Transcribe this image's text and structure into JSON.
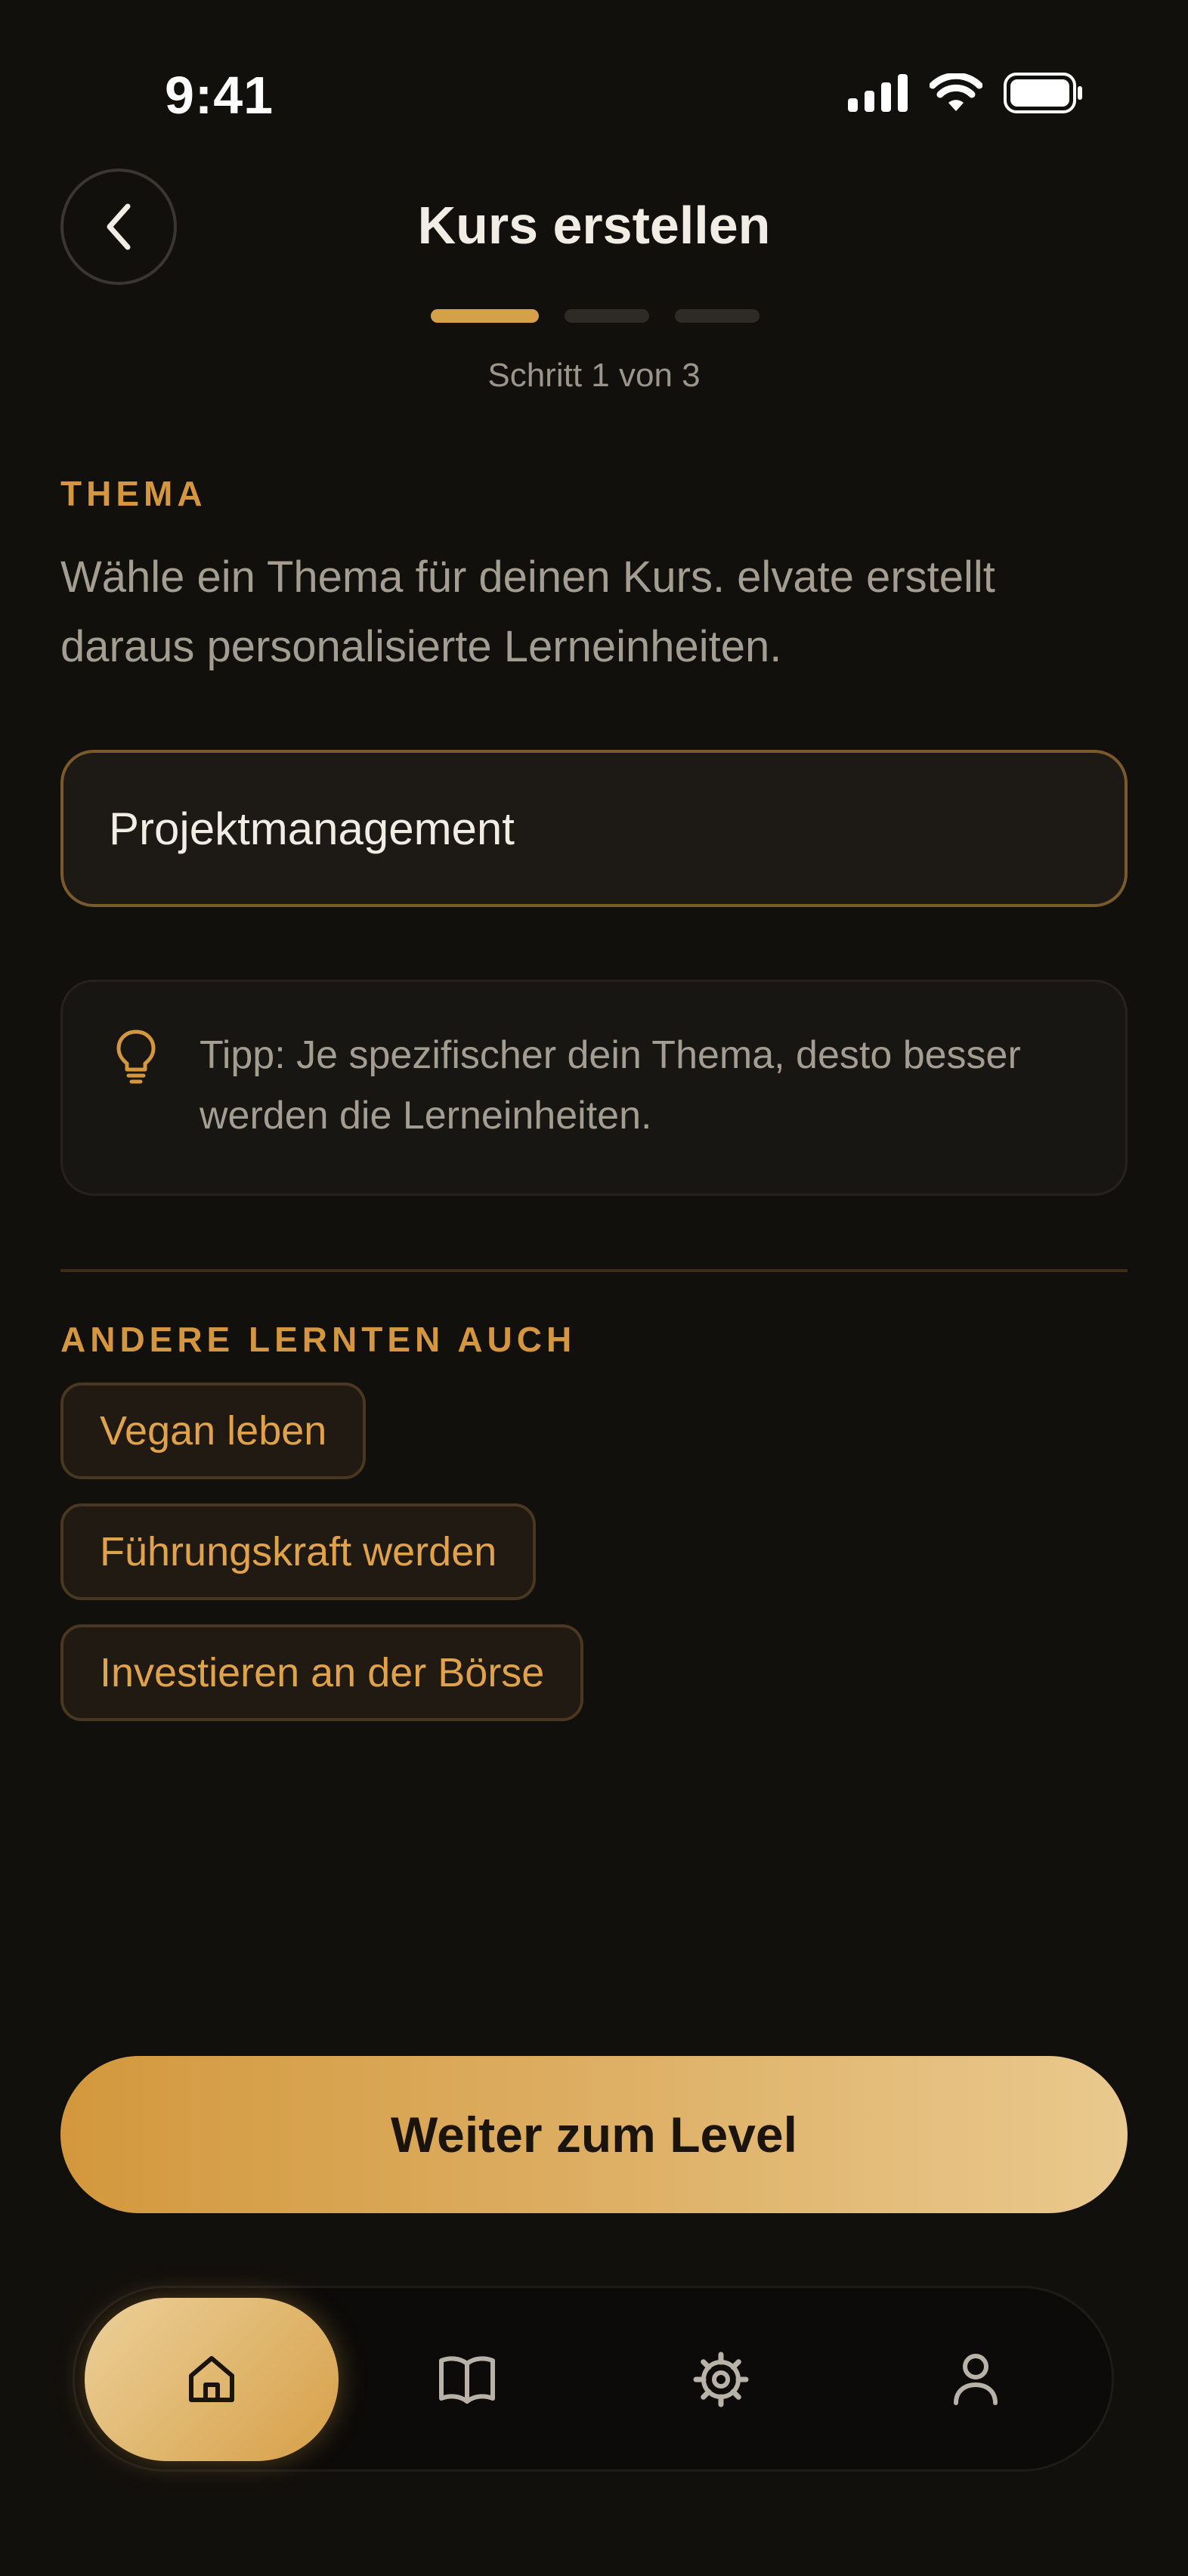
{
  "status_bar": {
    "time": "9:41"
  },
  "header": {
    "title": "Kurs erstellen",
    "step_label": "Schritt 1 von 3"
  },
  "topic": {
    "heading": "THEMA",
    "description": "Wähle ein Thema für deinen Kurs. elvate erstellt daraus personalisierte Lerneinheiten.",
    "input_value": "Projektmanagement"
  },
  "tip": {
    "icon": "lightbulb-icon",
    "text": "Tipp: Je spezifischer dein Thema, desto besser werden die Lerneinheiten."
  },
  "suggestions": {
    "heading": "ANDERE LERNTEN AUCH",
    "items": [
      "Vegan leben",
      "Führungskraft werden",
      "Investieren an der Börse"
    ]
  },
  "cta": {
    "label": "Weiter zum Level"
  },
  "nav": {
    "items": [
      {
        "icon": "home-icon",
        "active": true
      },
      {
        "icon": "book-icon",
        "active": false
      },
      {
        "icon": "gear-icon",
        "active": false
      },
      {
        "icon": "user-icon",
        "active": false
      }
    ]
  },
  "colors": {
    "background": "#12100d",
    "accent": "#d4963f",
    "accent_light": "#e9c98e"
  }
}
